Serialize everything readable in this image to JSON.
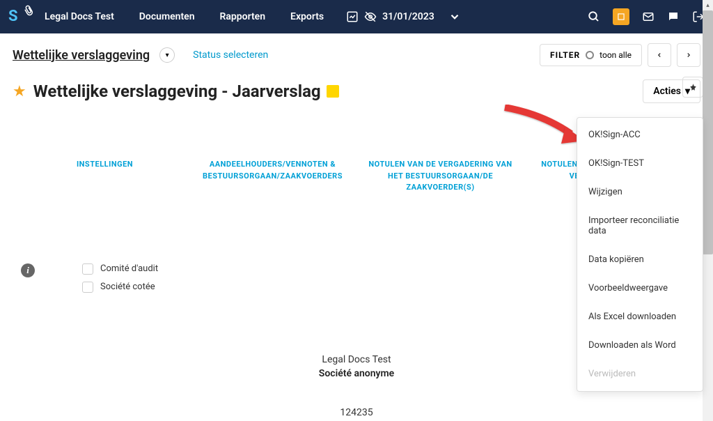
{
  "topbar": {
    "company": "Legal Docs Test",
    "nav": [
      "Documenten",
      "Rapporten",
      "Exports"
    ],
    "date": "31/01/2023"
  },
  "subheader": {
    "title": "Wettelijke verslaggeving",
    "status_link": "Status selecteren",
    "filter_label": "FILTER",
    "filter_value": "toon alle"
  },
  "page": {
    "title": "Wettelijke verslaggeving - Jaarverslag",
    "actions_label": "Acties"
  },
  "columns": {
    "c1": "INSTELLINGEN",
    "c2": "AANDEELHOUDERS/VENNOTEN & BESTUURSORGAAN/ZAAKVOERDERS",
    "c3": "NOTULEN VAN DE VERGADERING VAN HET BESTUURSORGAAN/DE ZAAKVOERDER(S)",
    "c4": "NOTULEN VAN DE ALGEMENE VERGADERING"
  },
  "checkboxes": {
    "c1": "Comité d'audit",
    "c2": "Société cotée"
  },
  "center": {
    "line1": "Legal Docs Test",
    "line2": "Société anonyme",
    "line3": "124235"
  },
  "menu": {
    "m1": "OK!Sign-ACC",
    "m2": "OK!Sign-TEST",
    "m3": "Wijzigen",
    "m4": "Importeer reconciliatie data",
    "m5": "Data kopiëren",
    "m6": "Voorbeeldweergave",
    "m7": "Als Excel downloaden",
    "m8": "Downloaden als Word",
    "m9": "Verwijderen"
  }
}
